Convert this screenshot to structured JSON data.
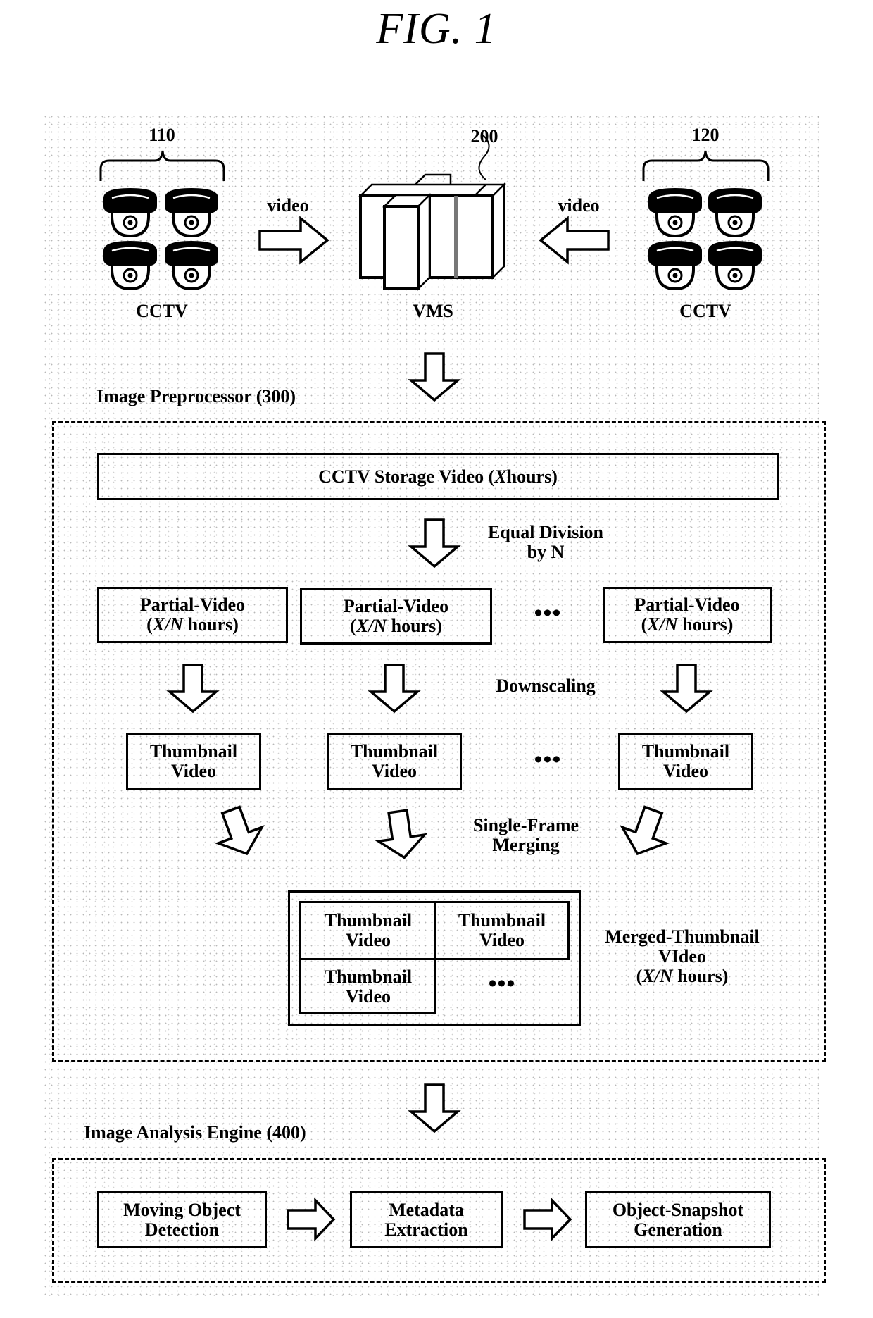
{
  "figure": {
    "title": "FIG. 1"
  },
  "top": {
    "cctv_left": {
      "ref": "110",
      "label": "CCTV",
      "camera_count": 4
    },
    "cctv_right": {
      "ref": "120",
      "label": "CCTV",
      "camera_count": 4
    },
    "vms": {
      "ref": "200",
      "label": "VMS"
    },
    "arrow_left_label": "video",
    "arrow_right_label": "video"
  },
  "preprocessor": {
    "title": "Image Preprocessor (300)",
    "storage": {
      "prefix": "CCTV Storage Video (",
      "var": "X",
      "suffix": " hours)"
    },
    "division_label": [
      "Equal Division",
      "by N"
    ],
    "partial": {
      "title": "Partial-Video",
      "var": "X/N",
      "suffix": " hours)",
      "count_shown": 3
    },
    "downscaling_label": "Downscaling",
    "thumbnail": {
      "line1": "Thumbnail",
      "line2": "Video"
    },
    "merging_label": [
      "Single-Frame",
      "Merging"
    ],
    "ellipsis": "•••",
    "merged": {
      "cells": [
        {
          "line1": "Thumbnail",
          "line2": "Video"
        },
        {
          "line1": "Thumbnail",
          "line2": "Video"
        },
        {
          "line1": "Thumbnail",
          "line2": "Video"
        }
      ],
      "label": [
        "Merged-Thumbnail",
        "VIdeo"
      ],
      "label_var": "X/N",
      "label_suffix": " hours)"
    }
  },
  "analysis": {
    "title": "Image Analysis Engine (400)",
    "steps": [
      {
        "line1": "Moving Object",
        "line2": "Detection"
      },
      {
        "line1": "Metadata",
        "line2": "Extraction"
      },
      {
        "line1": "Object-Snapshot",
        "line2": "Generation"
      }
    ]
  }
}
